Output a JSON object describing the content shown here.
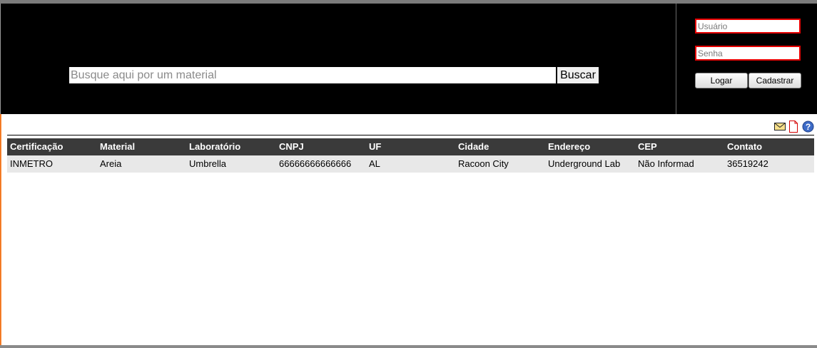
{
  "search": {
    "placeholder": "Busque aqui por um material",
    "button_label": "Buscar"
  },
  "login": {
    "user_placeholder": "Usuário",
    "password_placeholder": "Senha",
    "login_label": "Logar",
    "register_label": "Cadastrar"
  },
  "toolbar": {
    "icons": [
      "mail-icon",
      "pdf-icon",
      "help-icon"
    ]
  },
  "table": {
    "columns": [
      "Certificação",
      "Material",
      "Laboratório",
      "CNPJ",
      "UF",
      "Cidade",
      "Endereço",
      "CEP",
      "Contato"
    ],
    "rows": [
      [
        "INMETRO",
        "Areia",
        "Umbrella",
        "66666666666666",
        "AL",
        "Racoon City",
        "Underground Lab",
        "Não Informado",
        "36519242"
      ]
    ]
  },
  "colors": {
    "header_bg": "#000000",
    "input_border": "#e60000",
    "table_header_bg": "#3a3a3a",
    "table_row_bg": "#e8e8e8"
  }
}
